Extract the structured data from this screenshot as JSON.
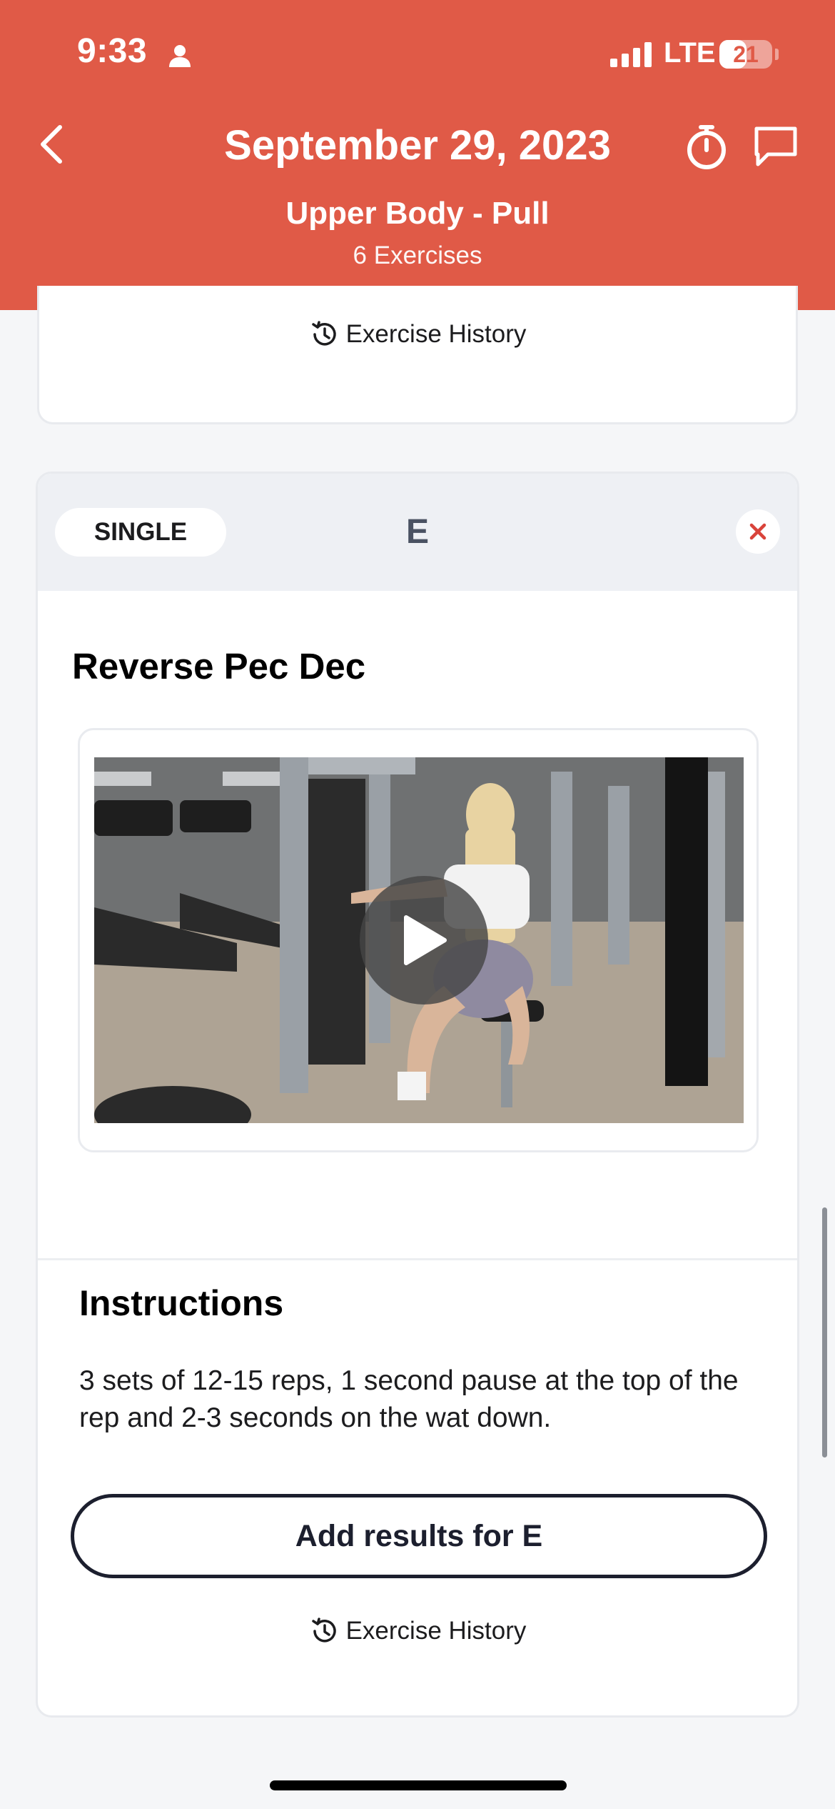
{
  "status_bar": {
    "time": "9:33",
    "network": "LTE",
    "battery": "21",
    "battery_level_percent": 21
  },
  "header": {
    "date": "September 29, 2023",
    "workout_name": "Upper Body - Pull",
    "exercise_count": "6 Exercises"
  },
  "previous_card": {
    "history_label": "Exercise History"
  },
  "exercise_card": {
    "badge": "SINGLE",
    "letter": "E",
    "name": "Reverse Pec Dec",
    "instructions_title": "Instructions",
    "instructions_text": "3 sets of 12-15 reps, 1 second pause at the top of the rep and 2-3 seconds on the wat down.",
    "add_results_label": "Add results for E",
    "history_label": "Exercise History"
  },
  "colors": {
    "header_bg": "#e05a47",
    "close_icon": "#d9433a",
    "button_border": "#1c1f2e"
  },
  "icons": [
    "person-icon",
    "back-icon",
    "stopwatch-icon",
    "chat-icon",
    "history-icon",
    "close-icon",
    "play-icon"
  ]
}
